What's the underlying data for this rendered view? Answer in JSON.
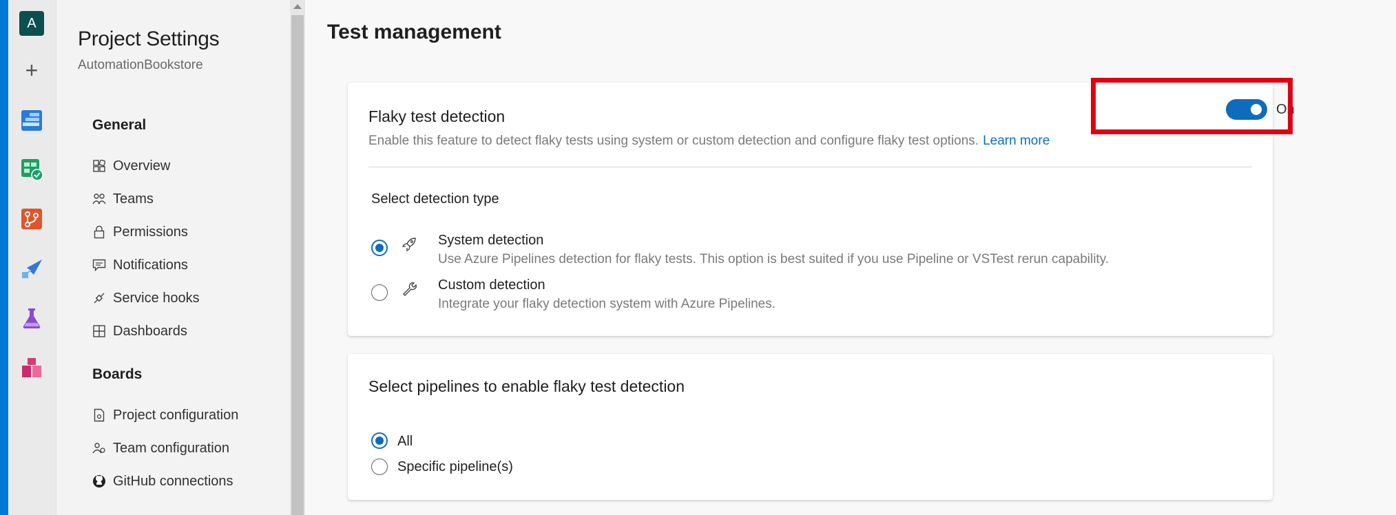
{
  "rail": {
    "avatar_letter": "A",
    "apps": [
      {
        "name": "overview",
        "color": "#0078d4"
      },
      {
        "name": "boards",
        "color": "#009e49"
      },
      {
        "name": "repos",
        "color": "#e05b2b"
      },
      {
        "name": "pipelines",
        "color": "#2f79d9"
      },
      {
        "name": "test-plans",
        "color": "#7e3fbf"
      },
      {
        "name": "artifacts",
        "color": "#cc2a6b"
      }
    ]
  },
  "sidebar": {
    "title": "Project Settings",
    "subtitle": "AutomationBookstore",
    "general_header": "General",
    "general_items": [
      {
        "label": "Overview",
        "icon": "overview-icon"
      },
      {
        "label": "Teams",
        "icon": "teams-icon"
      },
      {
        "label": "Permissions",
        "icon": "lock-icon"
      },
      {
        "label": "Notifications",
        "icon": "notifications-icon"
      },
      {
        "label": "Service hooks",
        "icon": "service-hooks-icon"
      },
      {
        "label": "Dashboards",
        "icon": "dashboards-icon"
      }
    ],
    "boards_header": "Boards",
    "boards_items": [
      {
        "label": "Project configuration",
        "icon": "project-configuration-icon"
      },
      {
        "label": "Team configuration",
        "icon": "team-configuration-icon"
      },
      {
        "label": "GitHub connections",
        "icon": "github-icon"
      }
    ]
  },
  "main": {
    "page_title": "Test management",
    "flaky": {
      "title": "Flaky test detection",
      "description": "Enable this feature to detect flaky tests using system or custom detection and configure flaky test options.",
      "learn_more": "Learn more",
      "toggle_label": "On",
      "toggle_on": true,
      "detection_header": "Select detection type",
      "options": [
        {
          "title": "System detection",
          "desc": "Use Azure Pipelines detection for flaky tests. This option is best suited if you use Pipeline or VSTest rerun capability.",
          "selected": true,
          "icon": "rocket-icon"
        },
        {
          "title": "Custom detection",
          "desc": "Integrate your flaky detection system with Azure Pipelines.",
          "selected": false,
          "icon": "wrench-icon"
        }
      ]
    },
    "pipelines": {
      "title": "Select pipelines to enable flaky test detection",
      "options": [
        {
          "label": "All",
          "selected": true
        },
        {
          "label": "Specific pipeline(s)",
          "selected": false
        }
      ]
    }
  }
}
